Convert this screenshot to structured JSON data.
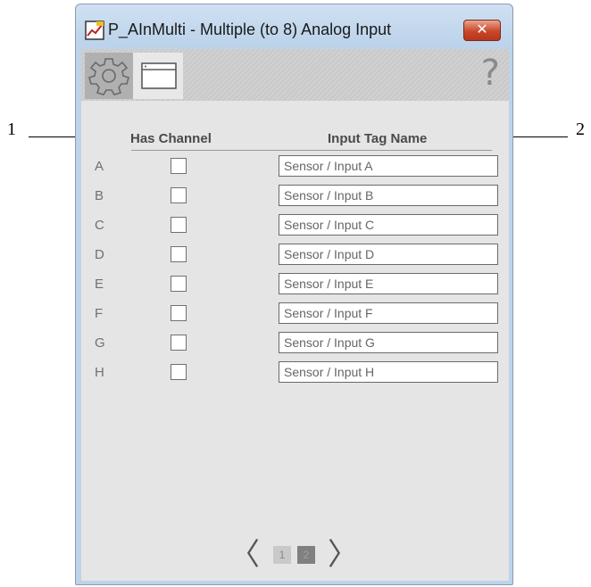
{
  "callouts": {
    "left": "1",
    "right": "2"
  },
  "window": {
    "title": "P_AInMulti - Multiple (to 8) Analog Input",
    "close_label": "✕"
  },
  "toolbar": {
    "help_label": "?"
  },
  "columns": {
    "has_channel": "Has Channel",
    "input_tag_name": "Input Tag Name"
  },
  "rows": [
    {
      "letter": "A",
      "tag": "Sensor / Input A"
    },
    {
      "letter": "B",
      "tag": "Sensor / Input B"
    },
    {
      "letter": "C",
      "tag": "Sensor / Input C"
    },
    {
      "letter": "D",
      "tag": "Sensor / Input D"
    },
    {
      "letter": "E",
      "tag": "Sensor / Input E"
    },
    {
      "letter": "F",
      "tag": "Sensor / Input F"
    },
    {
      "letter": "G",
      "tag": "Sensor / Input G"
    },
    {
      "letter": "H",
      "tag": "Sensor / Input H"
    }
  ],
  "pager": {
    "prev": "〈",
    "next": "〉",
    "pages": [
      "1",
      "2"
    ]
  }
}
